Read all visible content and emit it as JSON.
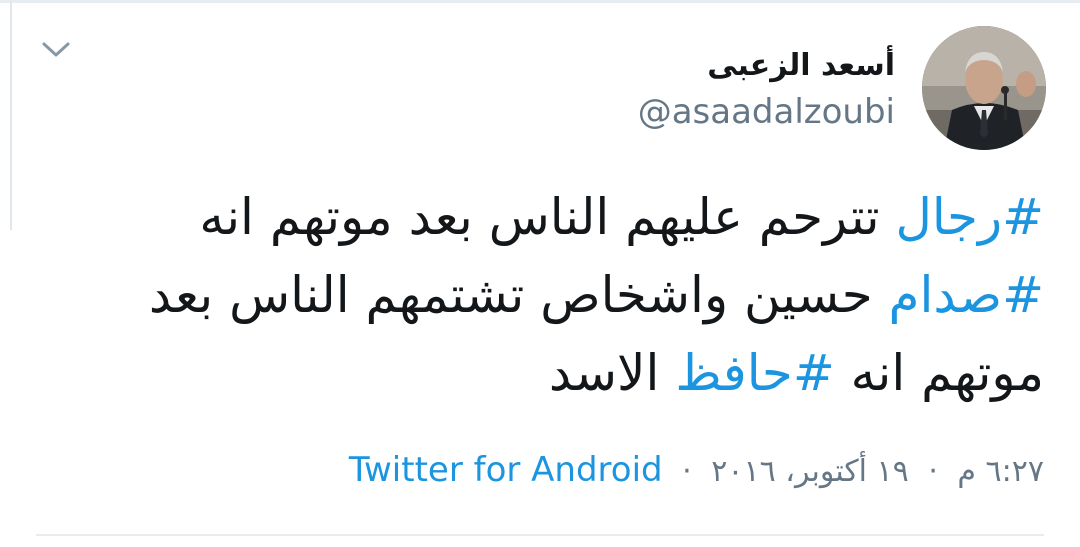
{
  "tweet": {
    "author_name": "أسعد الزعبى",
    "author_handle": "@asaadalzoubi",
    "text_parts": {
      "tag1": "#رجال",
      "t1": " تترحم عليهم الناس بعد موتهم انه ",
      "tag2": "#صدام",
      "t2": " حسين واشخاص تشتمهم الناس بعد موتهم انه ",
      "tag3": "#حافظ",
      "t3": " الاسد"
    },
    "time": "٦:٢٧ م",
    "date": "١٩ أكتوبر، ٢٠١٦",
    "separator": "·",
    "source": "Twitter for Android"
  },
  "icons": {
    "menu": "chevron-down-icon"
  },
  "colors": {
    "link": "#1b95e0",
    "secondary_text": "#657786",
    "primary_text": "#14171a",
    "divider": "#e6ecf0"
  }
}
